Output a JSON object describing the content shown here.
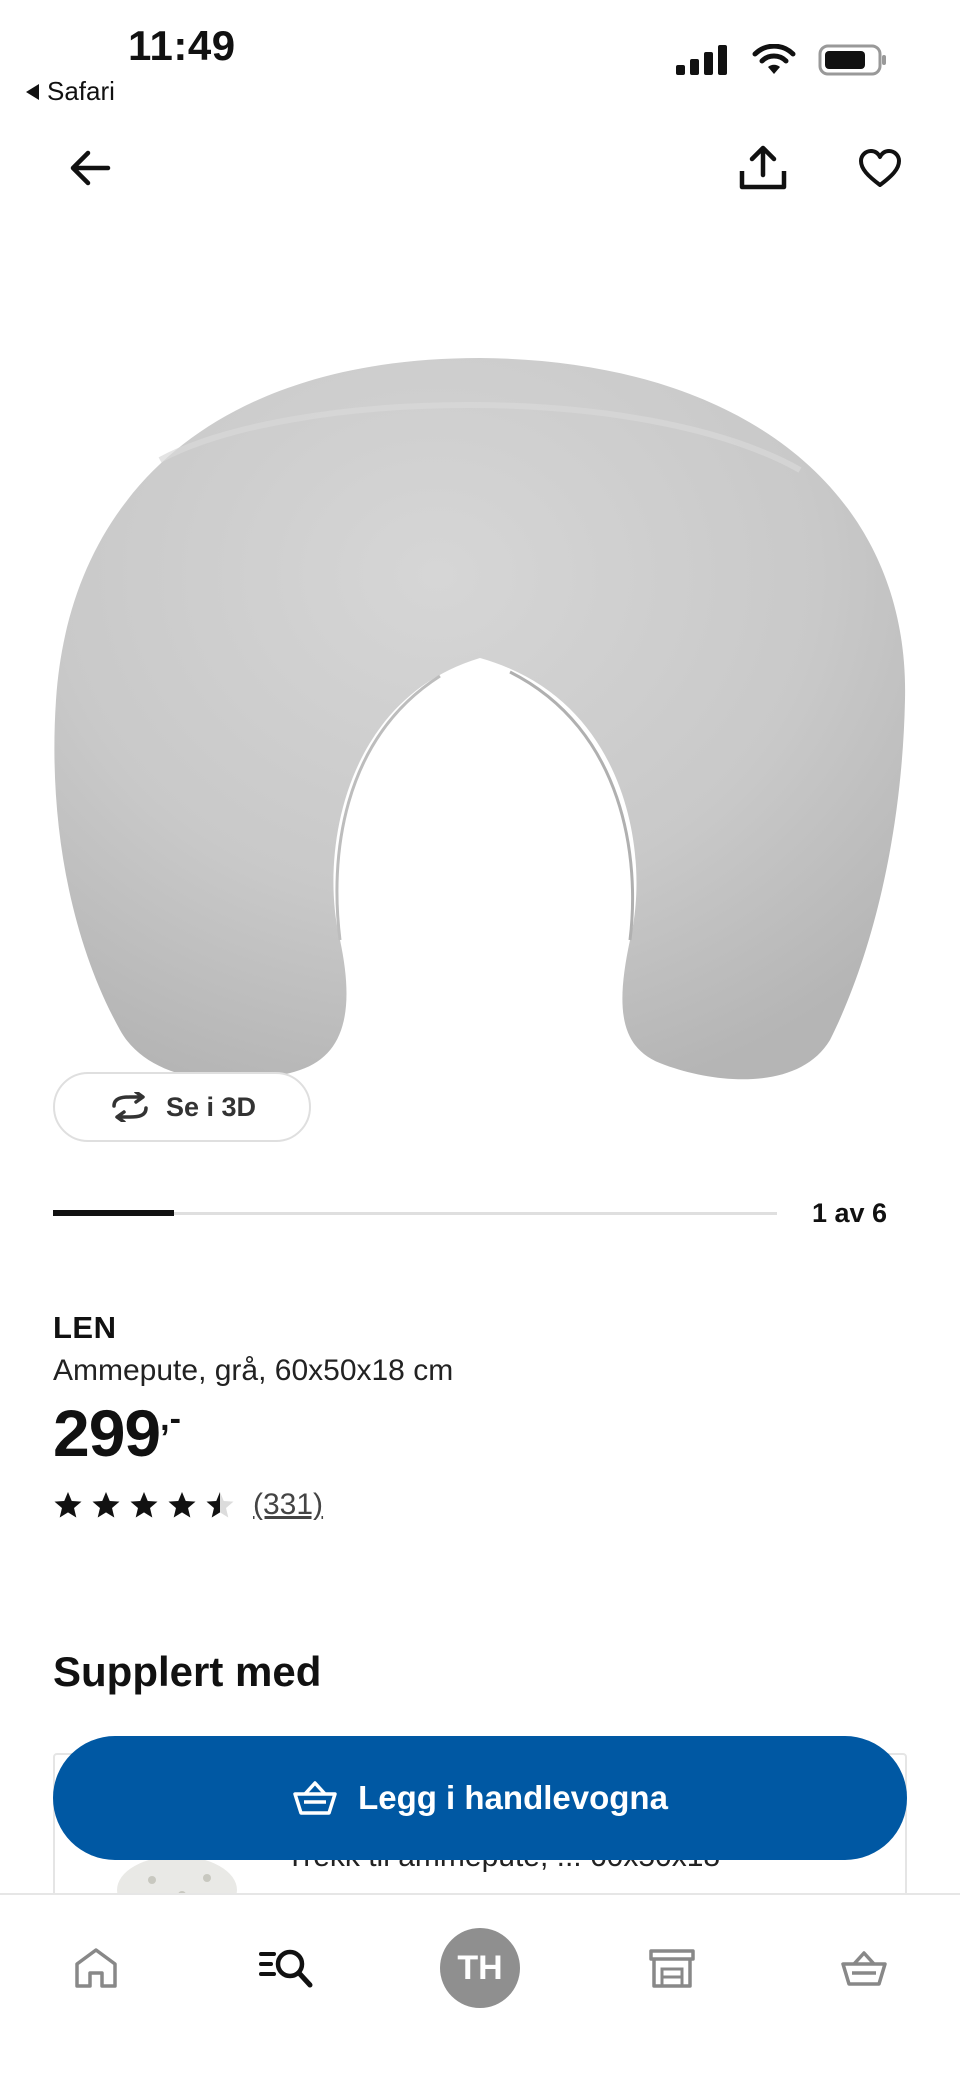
{
  "status_bar": {
    "time": "11:49",
    "back_app": "Safari",
    "icons": [
      "signal-icon",
      "wifi-icon",
      "battery-icon"
    ]
  },
  "header": {
    "icons": [
      "back-arrow-icon",
      "share-icon",
      "heart-icon"
    ]
  },
  "gallery": {
    "view_3d_label": "Se i 3D",
    "position_label": "1 av 6",
    "current": 1,
    "total": 6
  },
  "product": {
    "name": "LEN",
    "description": "Ammepute, grå, 60x50x18 cm",
    "price": "299",
    "price_suffix": ",-",
    "rating": 4.5,
    "rating_max": 5,
    "review_count": "(331)"
  },
  "supplement": {
    "title": "Supplert med",
    "item_text": "Trekk til ammepute, ... 60x50x18"
  },
  "cta": {
    "label": "Legg i handlevogna",
    "icon": "basket-icon"
  },
  "tabbar": {
    "items": [
      "home-icon",
      "search-list-icon",
      "profile-avatar",
      "store-icon",
      "cart-icon"
    ],
    "avatar_initials": "TH"
  },
  "colors": {
    "cta_blue": "#0058a3",
    "avatar_grey": "#8f8f8f",
    "pillow_grey": "#c9c9c9"
  }
}
